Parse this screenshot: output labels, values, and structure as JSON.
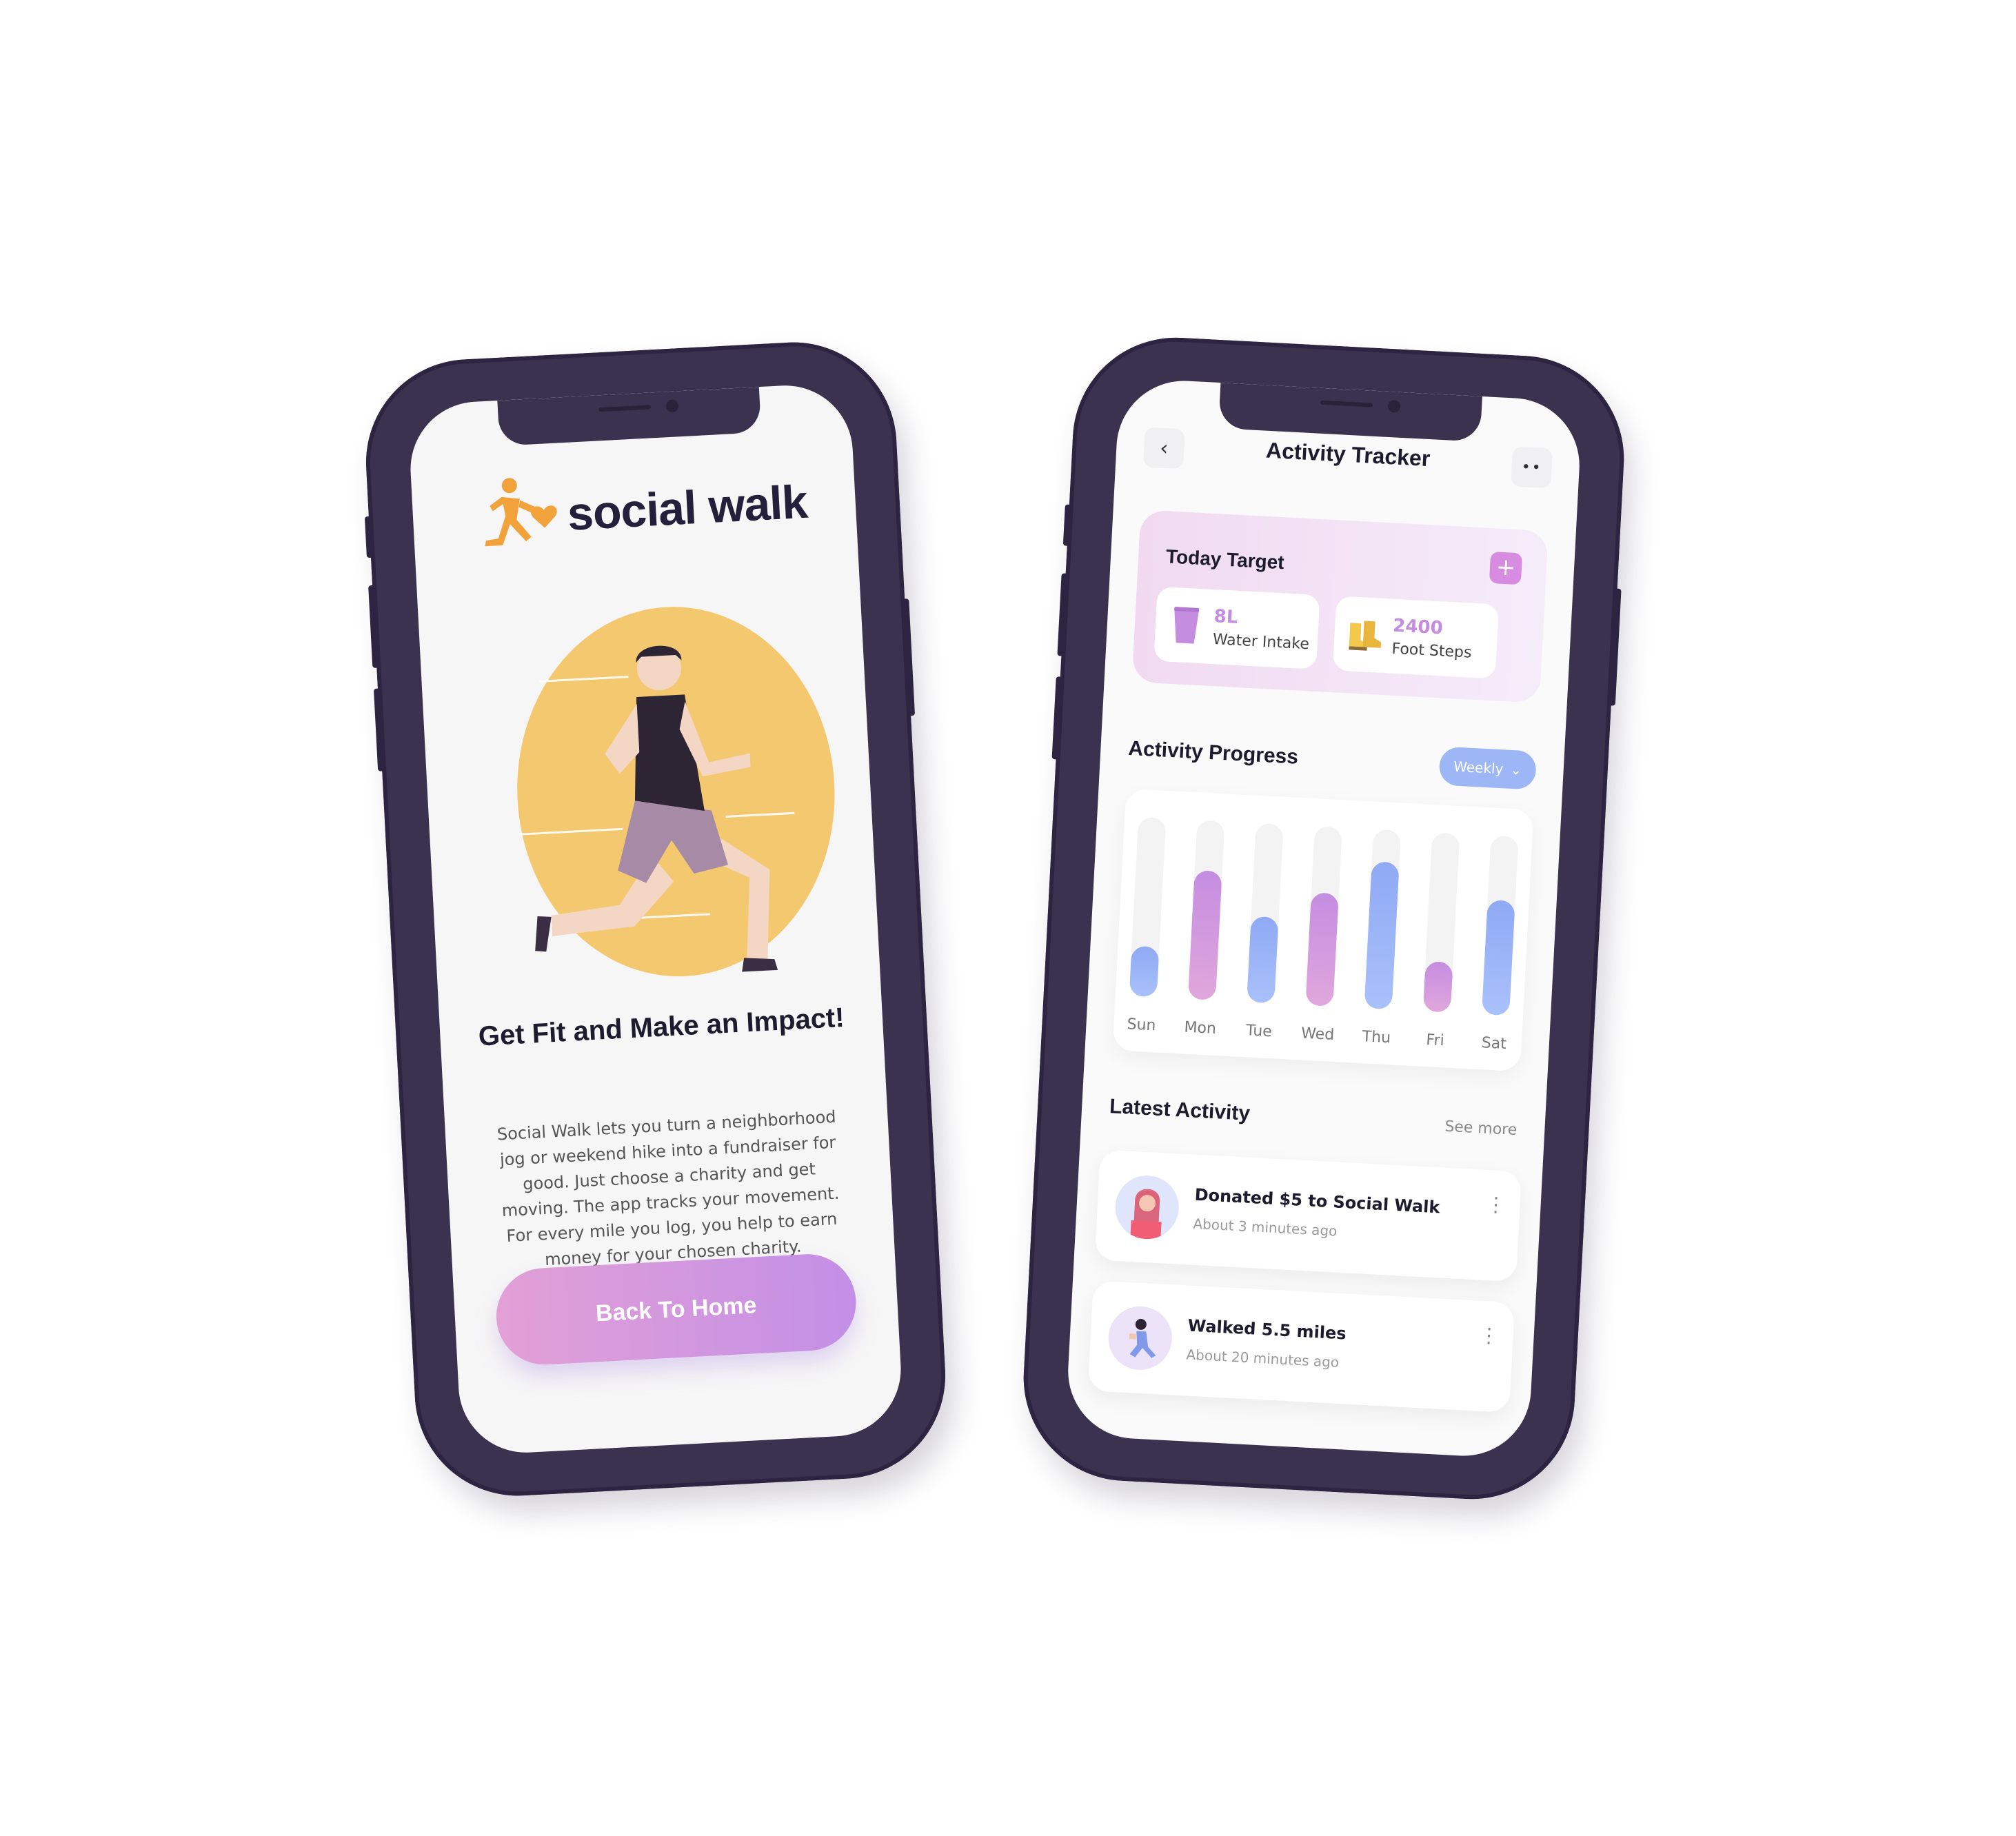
{
  "welcome": {
    "brand": "social walk",
    "title": "Get Fit and Make an Impact!",
    "body": "Social Walk lets you turn a neighborhood jog or weekend hike into a fundraiser for good. Just choose a charity and get moving. The app tracks your movement. For every mile you log, you help to earn money for your chosen charity.",
    "button": "Back To Home"
  },
  "tracker": {
    "title": "Activity Tracker",
    "back_icon": "chevron-left-icon",
    "more_icon": "more-dots-icon",
    "today_target": {
      "label": "Today Target",
      "add_icon": "plus-icon",
      "water": {
        "value": "8L",
        "label": "Water Intake"
      },
      "steps": {
        "value": "2400",
        "label": "Foot Steps"
      }
    },
    "progress": {
      "title": "Activity Progress",
      "period": "Weekly"
    },
    "latest": {
      "title": "Latest Activity",
      "see_more": "See more",
      "items": [
        {
          "title": "Donated $5 to Social Walk",
          "time": "About 3 minutes ago"
        },
        {
          "title": "Walked 5.5 miles",
          "time": "About 20 minutes ago"
        }
      ]
    }
  },
  "colors": {
    "frame": "#3b3250",
    "accent_purple": "#c58de0",
    "accent_blue": "#9db7f6",
    "hero_yellow": "#f4c86e"
  },
  "chart_data": {
    "type": "bar",
    "categories": [
      "Sun",
      "Mon",
      "Tue",
      "Wed",
      "Thu",
      "Fri",
      "Sat"
    ],
    "values": [
      0.28,
      0.72,
      0.48,
      0.63,
      0.82,
      0.28,
      0.64
    ],
    "ylim": [
      0,
      1
    ],
    "bar_colors": [
      "blue",
      "purple",
      "blue",
      "purple",
      "blue",
      "purple",
      "blue"
    ],
    "grid": false
  }
}
